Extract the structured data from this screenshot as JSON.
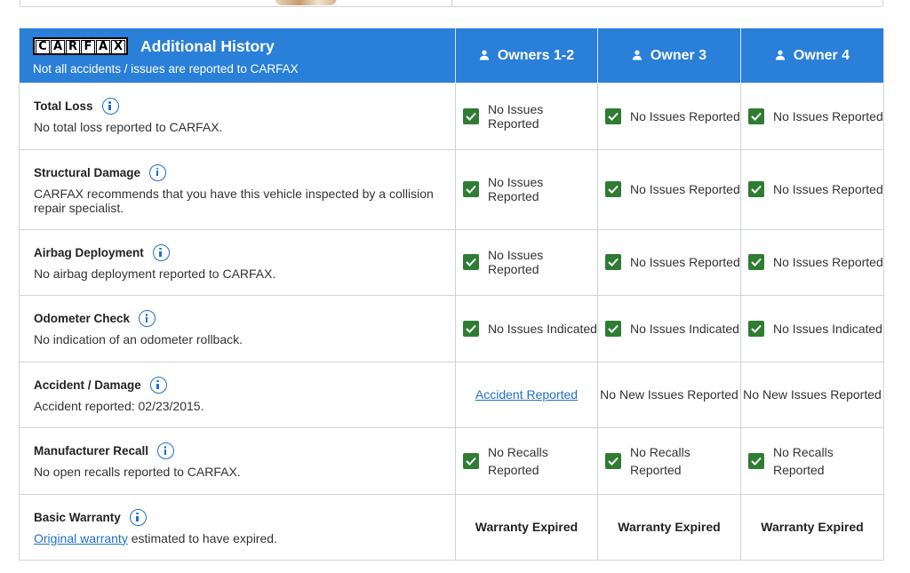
{
  "header": {
    "logo_letters": [
      "C",
      "A",
      "R",
      "F",
      "A",
      "X"
    ],
    "title": "Additional History",
    "subtitle": "Not all accidents / issues are reported to CARFAX",
    "owners": [
      "Owners 1-2",
      "Owner 3",
      "Owner 4"
    ]
  },
  "rows": [
    {
      "title": "Total Loss",
      "desc": "No total loss reported to CARFAX.",
      "cells": [
        "No Issues Reported",
        "No Issues Reported",
        "No Issues Reported"
      ]
    },
    {
      "title": "Structural Damage",
      "desc": "CARFAX recommends that you have this vehicle inspected by a collision repair specialist.",
      "cells": [
        "No Issues Reported",
        "No Issues Reported",
        "No Issues Reported"
      ]
    },
    {
      "title": "Airbag Deployment",
      "desc": "No airbag deployment reported to CARFAX.",
      "cells": [
        "No Issues Reported",
        "No Issues Reported",
        "No Issues Reported"
      ]
    },
    {
      "title": "Odometer Check",
      "desc": "No indication of an odometer rollback.",
      "cells": [
        "No Issues Indicated",
        "No Issues Indicated",
        "No Issues Indicated"
      ]
    },
    {
      "title": "Accident / Damage",
      "desc": "Accident reported: 02/23/2015.",
      "cells": [
        "Accident Reported",
        "No New Issues Reported",
        "No New Issues Reported"
      ]
    },
    {
      "title": "Manufacturer Recall",
      "desc": "No open recalls reported to CARFAX.",
      "cells_line1": [
        "No Recalls",
        "No Recalls",
        "No Recalls"
      ],
      "cells_line2": [
        "Reported",
        "Reported",
        "Reported"
      ]
    },
    {
      "title": "Basic Warranty",
      "desc_link": "Original warranty",
      "desc_rest": " estimated to have expired.",
      "cells": [
        "Warranty Expired",
        "Warranty Expired",
        "Warranty Expired"
      ]
    }
  ],
  "colors": {
    "header_blue": "#2a7fd8",
    "check_green": "#2e7d32",
    "link_blue": "#1f6fc9"
  }
}
